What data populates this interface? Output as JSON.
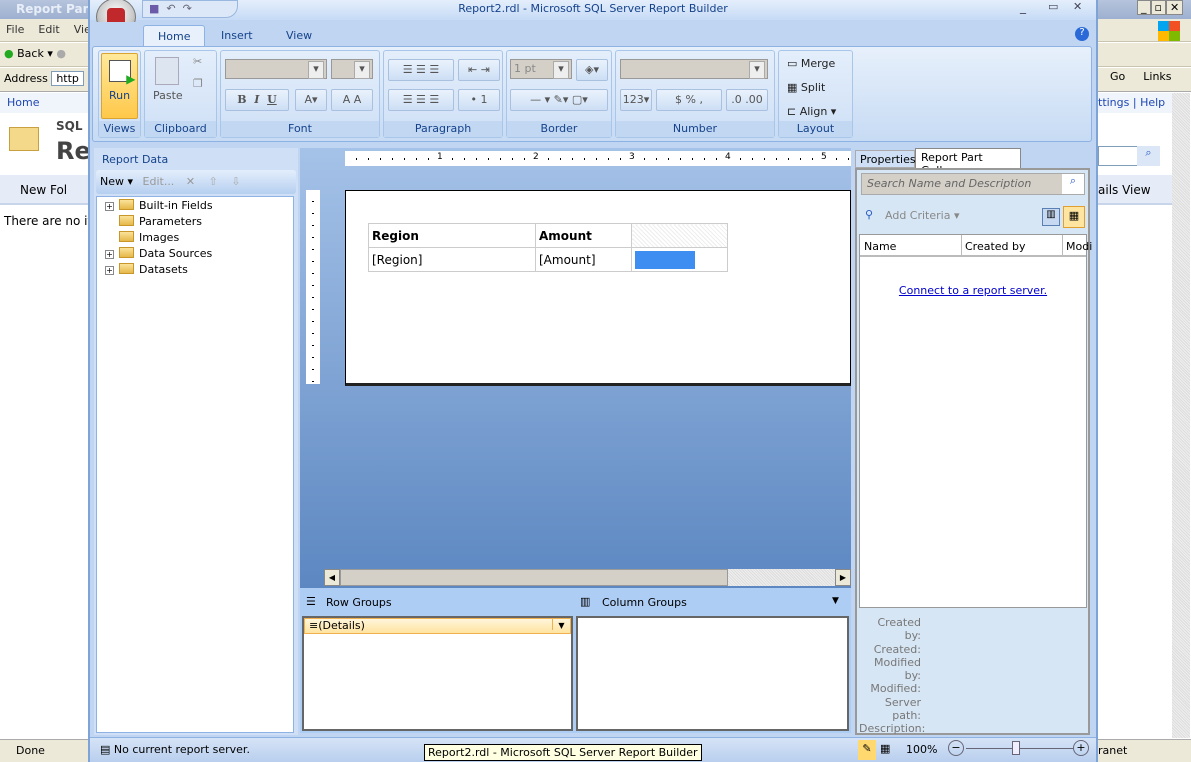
{
  "ie": {
    "title": "Report Parts",
    "menu": [
      "File",
      "Edit",
      "Vie"
    ],
    "back": "Back",
    "address_label": "Address",
    "address_value": "http",
    "go": "Go",
    "links": "Links",
    "home": "Home",
    "settings_help": "ttings | Help",
    "sql": "SQL",
    "re": "Re",
    "new_folder": "New Fol",
    "details_view": "ails View",
    "empty_text": "There are no it",
    "status": "Done",
    "zone": "ranet"
  },
  "app": {
    "title": "Report2.rdl - Microsoft SQL Server Report Builder",
    "tabs": [
      "Home",
      "Insert",
      "View"
    ],
    "ribbon": {
      "run": "Run",
      "paste": "Paste",
      "border_width": "1 pt",
      "merge": "Merge",
      "split": "Split",
      "align": "Align",
      "groups": [
        "Views",
        "Clipboard",
        "Font",
        "Paragraph",
        "Border",
        "Number",
        "Layout"
      ]
    },
    "report_data": {
      "title": "Report Data",
      "new": "New",
      "edit": "Edit...",
      "items": [
        "Built-in Fields",
        "Parameters",
        "Images",
        "Data Sources",
        "Datasets"
      ]
    },
    "ruler": [
      "1",
      "2",
      "3",
      "4",
      "5"
    ],
    "table": {
      "headers": [
        "Region",
        "Amount"
      ],
      "cells": [
        "[Region]",
        "[Amount]"
      ]
    },
    "groups": {
      "row": "Row Groups",
      "column": "Column Groups",
      "details": "(Details)"
    },
    "right_panel": {
      "tabs": [
        "Properties",
        "Report Part Gallery"
      ],
      "search_placeholder": "Search Name and Description",
      "add_criteria": "Add Criteria",
      "columns": [
        "Name",
        "Created by",
        "Modi"
      ],
      "connect": "Connect to a report server.",
      "meta": [
        "Created by:",
        "Created:",
        "Modified by:",
        "Modified:",
        "Server path:",
        "Description:"
      ]
    },
    "status": {
      "text": "No current report server.",
      "zoom": "100%",
      "tooltip": "Report2.rdl - Microsoft SQL Server Report Builder"
    }
  },
  "colors": {
    "accent": "#15428b",
    "selection": "#3d8ef0"
  }
}
